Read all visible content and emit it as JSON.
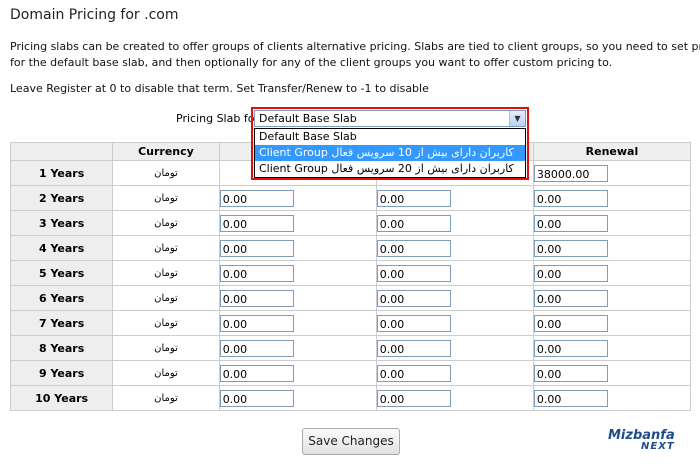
{
  "title": "Domain Pricing for .com",
  "intro_line1": "Pricing slabs can be created to offer groups of clients alternative pricing. Slabs are tied to client groups, so you need to set pricing",
  "intro_line2": "for the default base slab, and then optionally for any of the client groups you want to offer custom pricing to.",
  "note": "Leave Register at 0 to disable that term. Set Transfer/Renew to -1 to disable",
  "slab": {
    "label": "Pricing Slab for",
    "selected": "Default Base Slab",
    "options": [
      "Default Base Slab",
      "Client Group کاربران دارای بیش از 10 سرویس فعال",
      "Client Group کاربران دارای بیش از 20 سرویس فعال"
    ],
    "highlighted_index": 1
  },
  "table": {
    "headers": [
      "",
      "Currency",
      "",
      "",
      "Renewal"
    ],
    "rows": [
      {
        "term": "1 Years",
        "currency": "تومان",
        "renewal": "38000.00"
      },
      {
        "term": "2 Years",
        "currency": "تومان",
        "register": "0.00",
        "transfer": "0.00",
        "renewal": "0.00"
      },
      {
        "term": "3 Years",
        "currency": "تومان",
        "register": "0.00",
        "transfer": "0.00",
        "renewal": "0.00"
      },
      {
        "term": "4 Years",
        "currency": "تومان",
        "register": "0.00",
        "transfer": "0.00",
        "renewal": "0.00"
      },
      {
        "term": "5 Years",
        "currency": "تومان",
        "register": "0.00",
        "transfer": "0.00",
        "renewal": "0.00"
      },
      {
        "term": "6 Years",
        "currency": "تومان",
        "register": "0.00",
        "transfer": "0.00",
        "renewal": "0.00"
      },
      {
        "term": "7 Years",
        "currency": "تومان",
        "register": "0.00",
        "transfer": "0.00",
        "renewal": "0.00"
      },
      {
        "term": "8 Years",
        "currency": "تومان",
        "register": "0.00",
        "transfer": "0.00",
        "renewal": "0.00"
      },
      {
        "term": "9 Years",
        "currency": "تومان",
        "register": "0.00",
        "transfer": "0.00",
        "renewal": "0.00"
      },
      {
        "term": "10 Years",
        "currency": "تومان",
        "register": "0.00",
        "transfer": "0.00",
        "renewal": "0.00"
      }
    ]
  },
  "save_label": "Save Changes",
  "logo": {
    "name": "Mizbanfa",
    "sub": "NEXT"
  }
}
